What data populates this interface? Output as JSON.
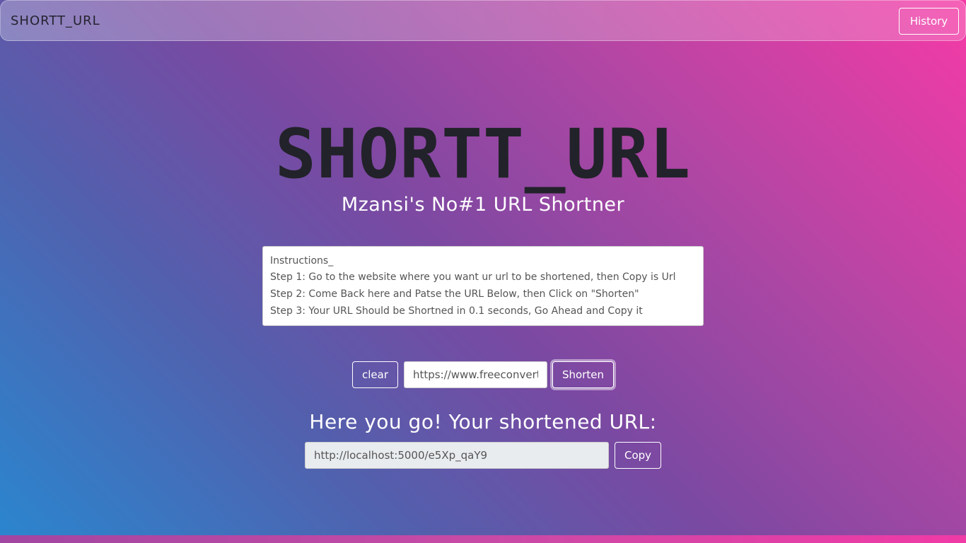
{
  "navbar": {
    "brand": "SHORTT_URL",
    "history_label": "History"
  },
  "hero": {
    "title": "SHORTT_URL",
    "subtitle": "Mzansi's No#1 URL Shortner"
  },
  "instructions": {
    "heading": "Instructions_",
    "steps": [
      "Step 1: Go to the website where you want ur url to be shortened, then Copy is Url",
      "Step 2: Come Back here and Patse the URL Below, then Click on \"Shorten\"",
      "Step 3: Your URL Should be Shortned in 0.1 seconds, Go Ahead and Copy it"
    ]
  },
  "form": {
    "clear_label": "clear",
    "url_value": "https://www.freeconvert",
    "shorten_label": "Shorten"
  },
  "result": {
    "title": "Here you go! Your shortened URL:",
    "short_url": "http://localhost:5000/e5Xp_qaY9",
    "copy_label": "Copy"
  }
}
